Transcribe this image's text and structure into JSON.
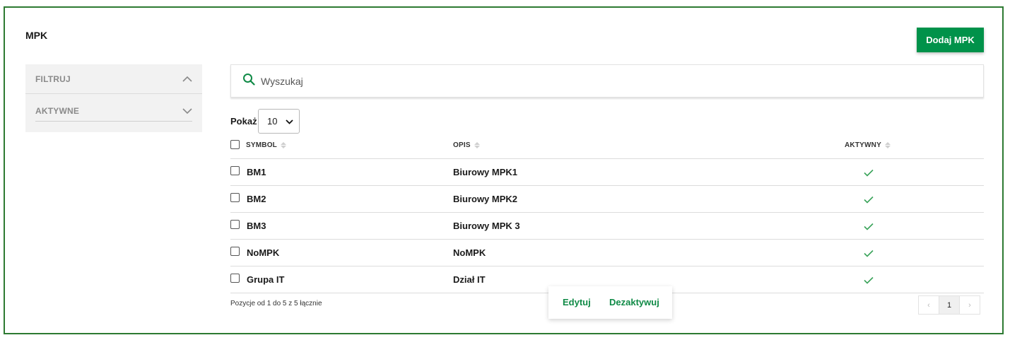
{
  "page": {
    "title": "MPK",
    "add_button": "Dodaj MPK"
  },
  "filters": {
    "items": [
      {
        "label": "FILTRUJ",
        "expanded": true
      },
      {
        "label": "AKTYWNE",
        "expanded": false
      }
    ]
  },
  "search": {
    "placeholder": "Wyszukaj",
    "value": ""
  },
  "page_size": {
    "label": "Pokaż",
    "value": "10"
  },
  "table": {
    "columns": [
      "SYMBOL",
      "OPIS",
      "AKTYWNY"
    ],
    "rows": [
      {
        "symbol": "BM1",
        "opis": "Biurowy MPK1",
        "aktywny": true
      },
      {
        "symbol": "BM2",
        "opis": "Biurowy MPK2",
        "aktywny": true
      },
      {
        "symbol": "BM3",
        "opis": "Biurowy MPK 3",
        "aktywny": true
      },
      {
        "symbol": "NoMPK",
        "opis": "NoMPK",
        "aktywny": true
      },
      {
        "symbol": "Grupa IT",
        "opis": "Dział IT",
        "aktywny": true
      }
    ]
  },
  "summary": "Pozycje od 1 do 5 z 5 łącznie",
  "row_actions": {
    "edit": "Edytuj",
    "deactivate": "Dezaktywuj"
  },
  "pagination": {
    "prev": "‹",
    "current": "1",
    "next": "›"
  },
  "colors": {
    "accent": "#00924a",
    "frame": "#2d7a32",
    "check": "#3aa35a"
  },
  "icons": {
    "search": "search-icon",
    "expand": "chevron-up-icon",
    "collapse": "chevron-down-icon",
    "active": "check-icon"
  }
}
